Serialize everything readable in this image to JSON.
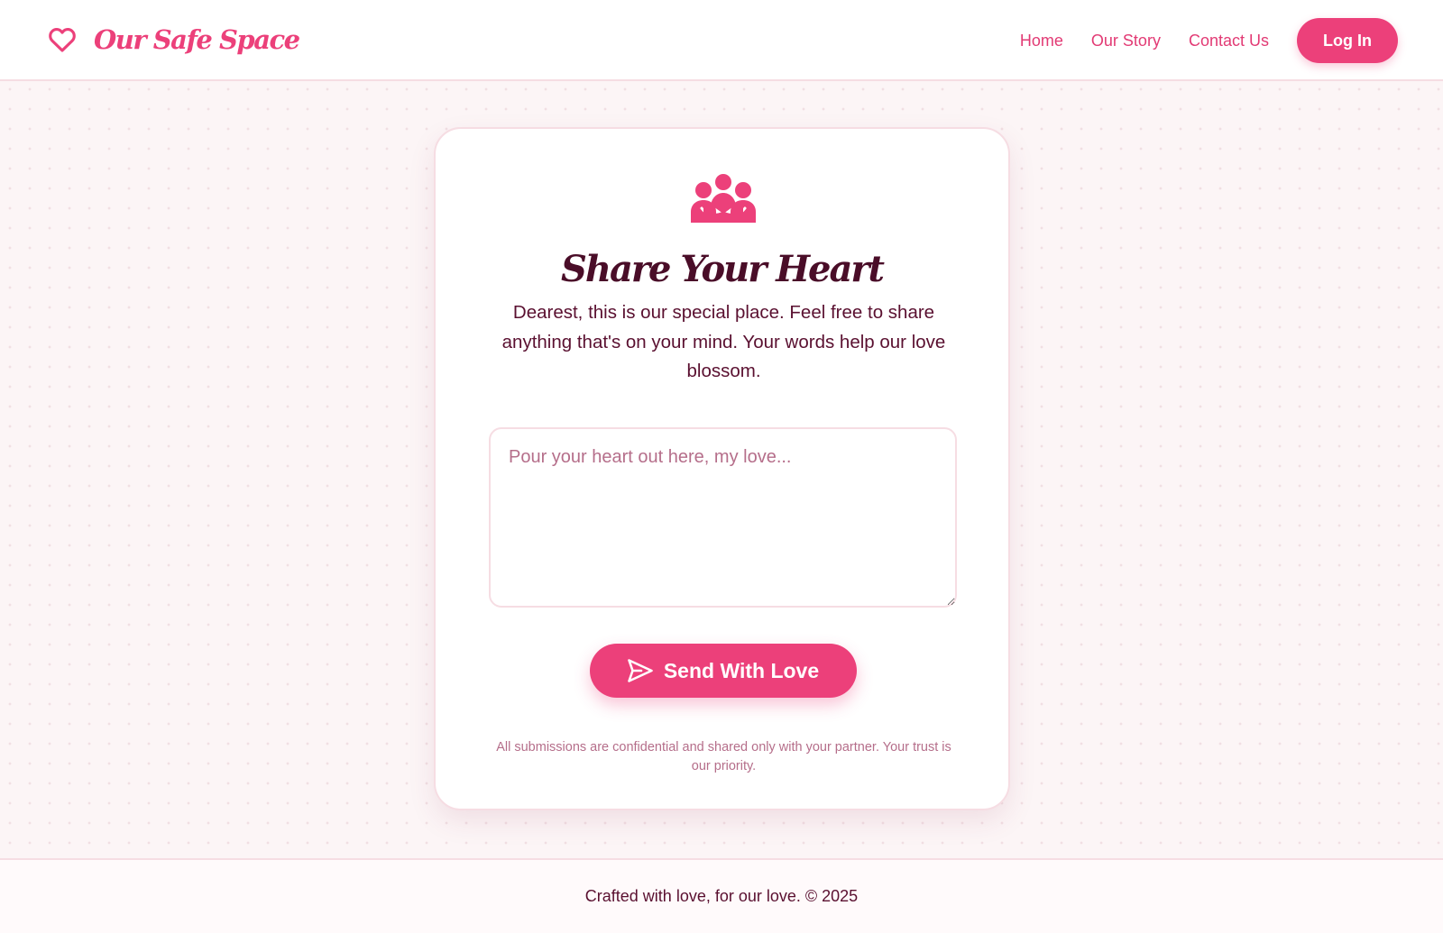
{
  "colors": {
    "accent": "#ec407a",
    "text_dark": "#4a0d28",
    "text_body": "#5a1030",
    "muted": "#b56e8a",
    "border": "#f6dde3",
    "background": "#fcf5f6"
  },
  "header": {
    "brand_icon": "heart-outline-icon",
    "brand_name": "Our Safe Space",
    "nav": [
      {
        "label": "Home"
      },
      {
        "label": "Our Story"
      },
      {
        "label": "Contact Us"
      }
    ],
    "login_label": "Log In"
  },
  "card": {
    "icon": "people-group-icon",
    "title": "Share Your Heart",
    "description": "Dearest, this is our special place. Feel free to share anything that's on your mind. Your words help our love blossom.",
    "message_placeholder": "Pour your heart out here, my love...",
    "message_value": "",
    "send_icon": "paper-plane-icon",
    "send_label": "Send With Love",
    "note": "All submissions are confidential and shared only with your partner. Your trust is our priority."
  },
  "footer": {
    "text": "Crafted with love, for our love. © 2025"
  }
}
